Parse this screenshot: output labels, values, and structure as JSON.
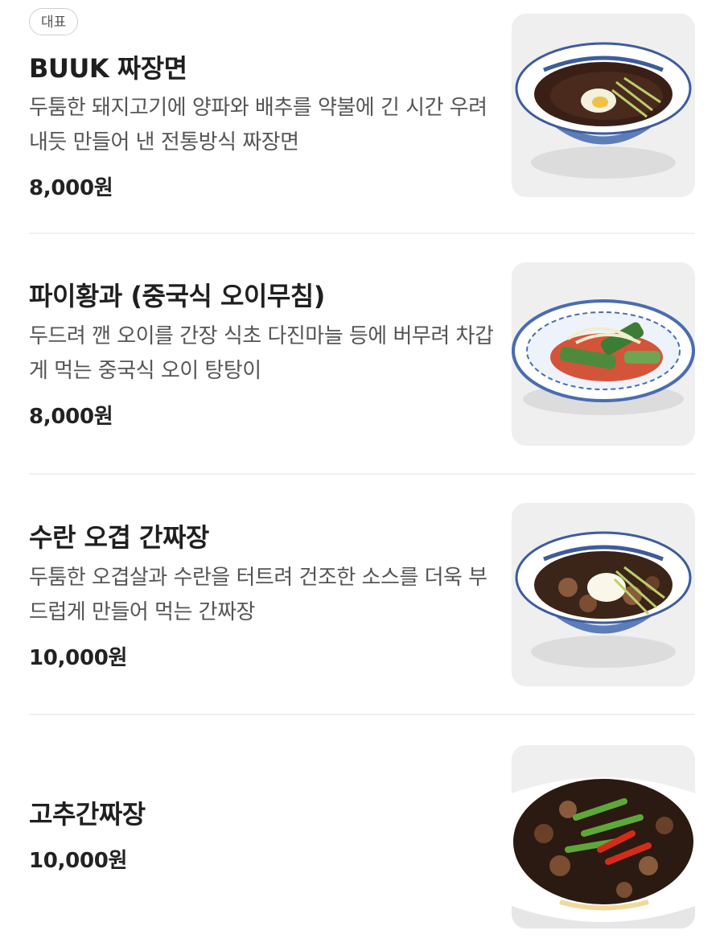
{
  "menu": {
    "items": [
      {
        "badge": "대표",
        "name": "BUUK 짜장면",
        "description": "두툼한 돼지고기에 양파와 배추를 약불에 긴 시간 우려내듯 만들어 낸 전통방식 짜장면",
        "price": "8,000원",
        "image": "jjajangmyeon-bowl-photo"
      },
      {
        "name": "파이황과 (중국식 오이무침)",
        "description": "두드려 깬 오이를 간장 식초 다진마늘 등에 버무려 차갑게 먹는 중국식 오이 탕탕이",
        "price": "8,000원",
        "image": "cucumber-salad-plate-photo"
      },
      {
        "name": "수란 오겹 간짜장",
        "description": "두툼한 오겹살과 수란을 터트려 건조한 소스를 더욱 부드럽게 만들어 먹는 간짜장",
        "price": "10,000원",
        "image": "gan-jjajang-bowl-photo"
      },
      {
        "name": "고추간짜장",
        "price": "10,000원",
        "image": "pepper-gan-jjajang-bowl-photo"
      }
    ]
  }
}
